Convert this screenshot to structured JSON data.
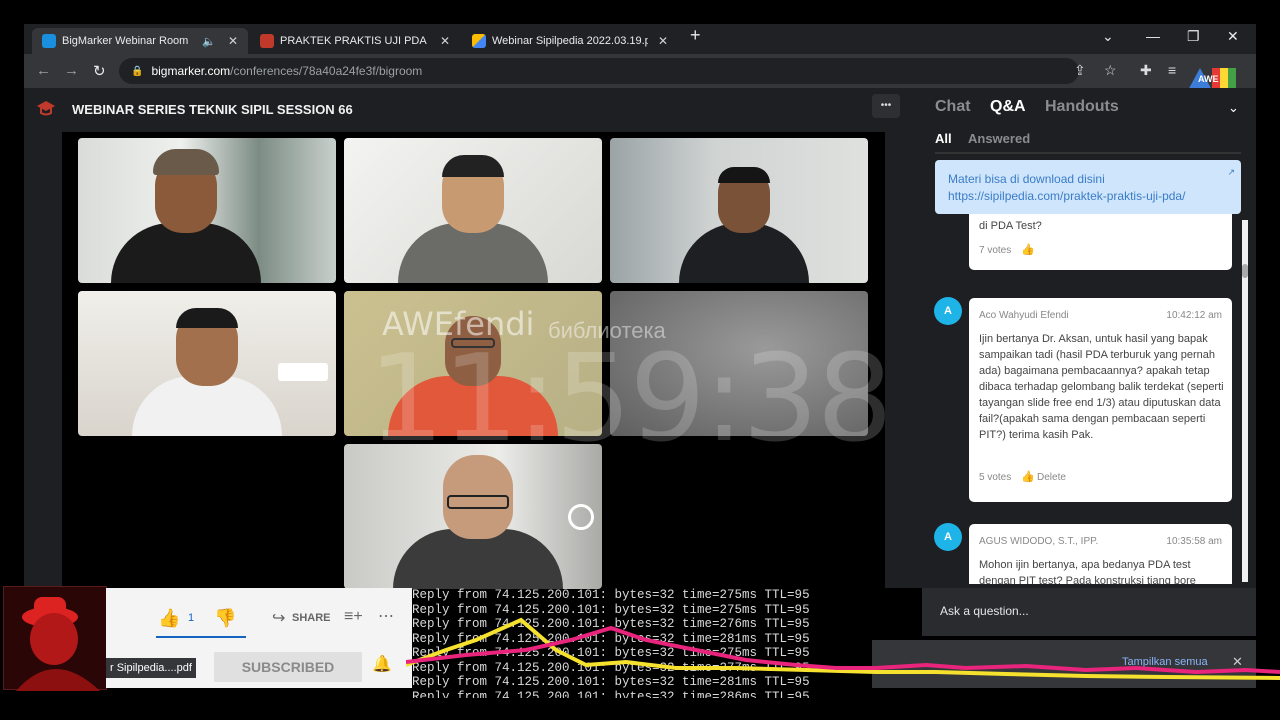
{
  "browser": {
    "tabs": [
      {
        "label": "BigMarker Webinar Room",
        "close": "✕"
      },
      {
        "label": "PRAKTEK PRAKTIS UJI PDA | Sipil",
        "close": "✕"
      },
      {
        "label": "Webinar Sipilpedia 2022.03.19.pd",
        "close": "✕"
      }
    ],
    "new_tab": "+",
    "url_domain": "bigmarker.com",
    "url_path": "/conferences/78a40a24fe3f/bigroom"
  },
  "page": {
    "title": "WEBINAR SERIES TEKNIK SIPIL SESSION 66",
    "more": "•••"
  },
  "overlay": {
    "brand": "AWEfendi",
    "sub": "библиотека",
    "clock": "11:59:38",
    "corner_logo": "AWE"
  },
  "panel": {
    "tabs": [
      "Chat",
      "Q&A",
      "Handouts"
    ],
    "active_tab": "Q&A",
    "subtabs": [
      "All",
      "Answered"
    ],
    "pinned_line1": "Materi bisa di download disini",
    "pinned_line2": "https://sipilpedia.com/praktek-praktis-uji-pda/",
    "cards": [
      {
        "question": "di PDA Test?",
        "votes": "7 votes"
      },
      {
        "avatar": "A",
        "name": "Aco Wahyudi Efendi",
        "time": "10:42:12 am",
        "question": "Ijin bertanya Dr. Aksan, untuk hasil yang bapak sampaikan tadi (hasil PDA terburuk yang pernah ada) bagaimana pembacaannya? apakah tetap dibaca terhadap gelombang balik terdekat (seperti tayangan slide free end 1/3) atau diputuskan data fail?(apakah sama dengan pembacaan seperti PIT?) terima kasih Pak.",
        "votes": "5 votes",
        "delete": "Delete"
      },
      {
        "avatar": "A",
        "name": "AGUS WIDODO, S.T., IPP.",
        "time": "10:35:58 am",
        "question": "Mohon ijin bertanya, apa bedanya PDA test dengan PIT test? Pada konstruksi tiang bore"
      }
    ],
    "ask_placeholder": "Ask a question..."
  },
  "youtube": {
    "likes": "1",
    "share": "SHARE",
    "subscribed": "SUBSCRIBED",
    "file_label": "r Sipilpedia....pdf"
  },
  "ping_lines": [
    "Reply from 74.125.200.101: bytes=32 time=275ms TTL=95",
    "Reply from 74.125.200.101: bytes=32 time=275ms TTL=95",
    "Reply from 74.125.200.101: bytes=32 time=276ms TTL=95",
    "Reply from 74.125.200.101: bytes=32 time=281ms TTL=95",
    "Reply from 74.125.200.101: bytes=32 time=275ms TTL=95",
    "Reply from 74.125.200.101: bytes=32 time=277ms TTL=95",
    "Reply from 74.125.200.101: bytes=32 time=281ms TTL=95",
    "Reply from 74.125.200.101: bytes=32 time=286ms TTL=95"
  ],
  "download_bar": {
    "show_all": "Tampilkan semua",
    "close": "✕"
  }
}
